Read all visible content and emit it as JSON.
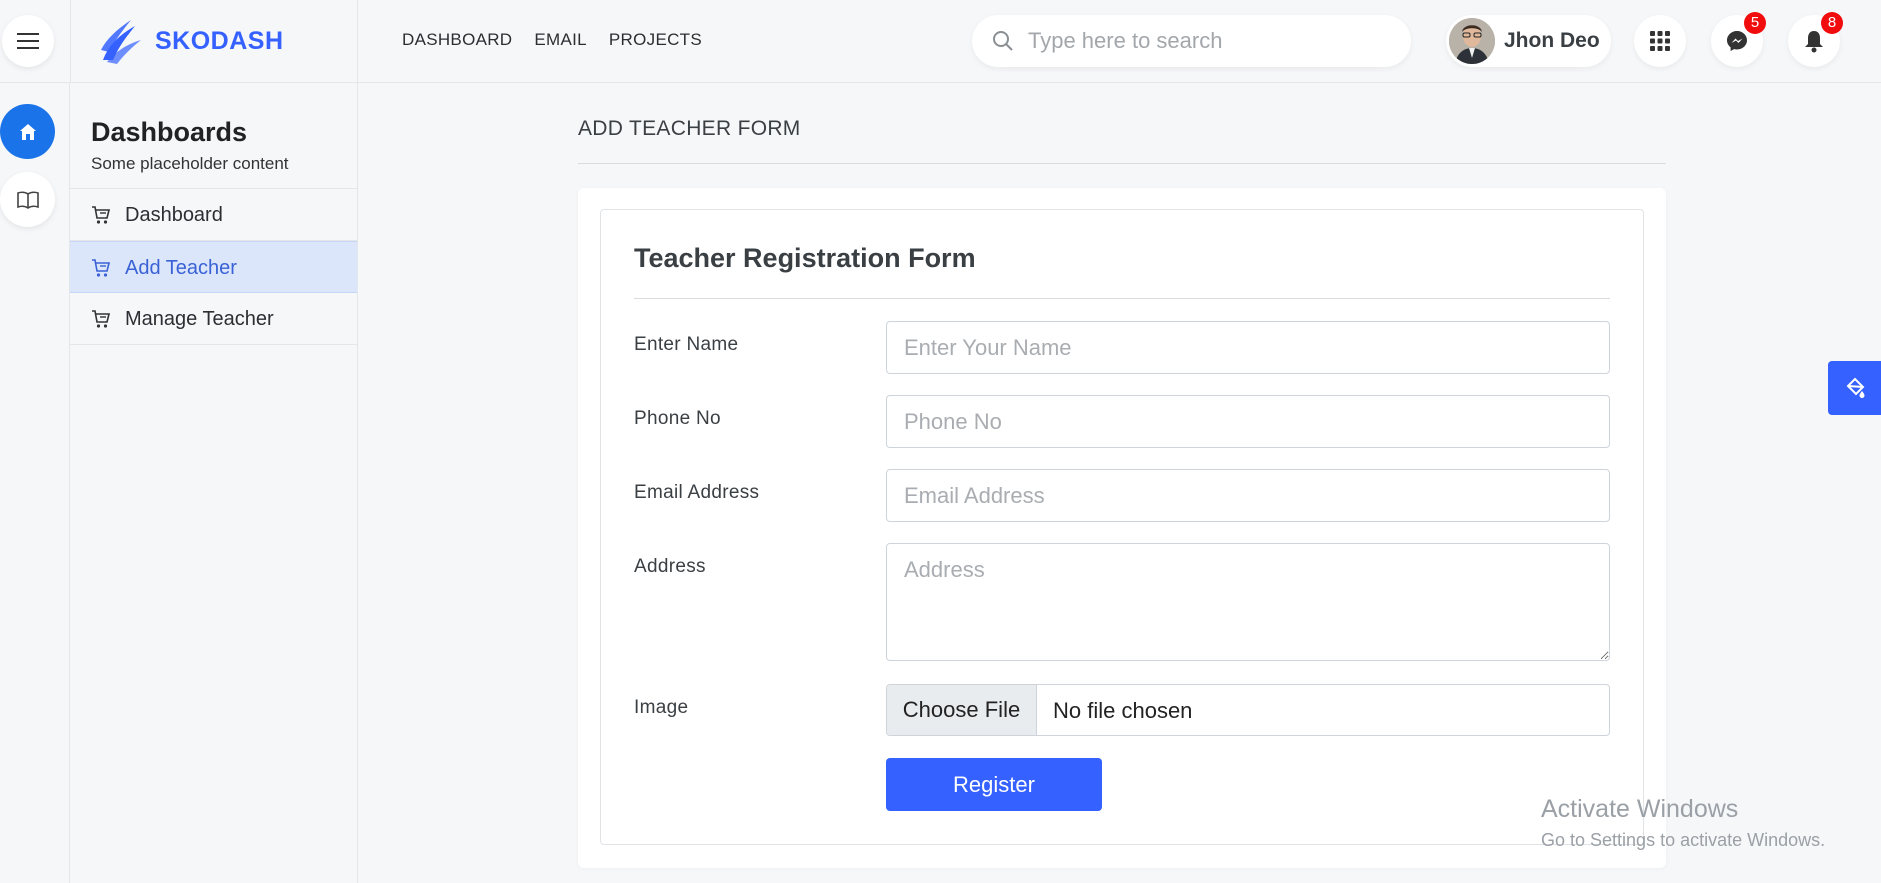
{
  "brand": {
    "name": "SKODASH",
    "accent": "#3461ff"
  },
  "topnav": [
    {
      "label": "DASHBOARD"
    },
    {
      "label": "EMAIL"
    },
    {
      "label": "PROJECTS"
    }
  ],
  "search": {
    "placeholder": "Type here to search",
    "value": ""
  },
  "user": {
    "name": "Jhon Deo"
  },
  "notifications": {
    "messages_count": "5",
    "alerts_count": "8"
  },
  "sidebar": {
    "title": "Dashboards",
    "subtitle": "Some placeholder content",
    "items": [
      {
        "label": "Dashboard",
        "active": false
      },
      {
        "label": "Add Teacher",
        "active": true
      },
      {
        "label": "Manage Teacher",
        "active": false
      }
    ]
  },
  "page": {
    "title": "ADD TEACHER FORM"
  },
  "form": {
    "title": "Teacher Registration Form",
    "fields": [
      {
        "label": "Enter Name",
        "placeholder": "Enter Your Name",
        "value": ""
      },
      {
        "label": "Phone No",
        "placeholder": "Phone No",
        "value": ""
      },
      {
        "label": "Email Address",
        "placeholder": "Email Address",
        "value": ""
      },
      {
        "label": "Address",
        "placeholder": "Address",
        "value": ""
      }
    ],
    "image": {
      "label": "Image",
      "button": "Choose File",
      "status": "No file chosen"
    },
    "submit_label": "Register"
  },
  "watermark": {
    "line1": "Activate Windows",
    "line2": "Go to Settings to activate Windows."
  },
  "icons": [
    "menu-icon",
    "search-icon",
    "apps-grid-icon",
    "messenger-icon",
    "bell-icon",
    "home-icon",
    "book-icon",
    "cart-icon",
    "paint-icon"
  ]
}
